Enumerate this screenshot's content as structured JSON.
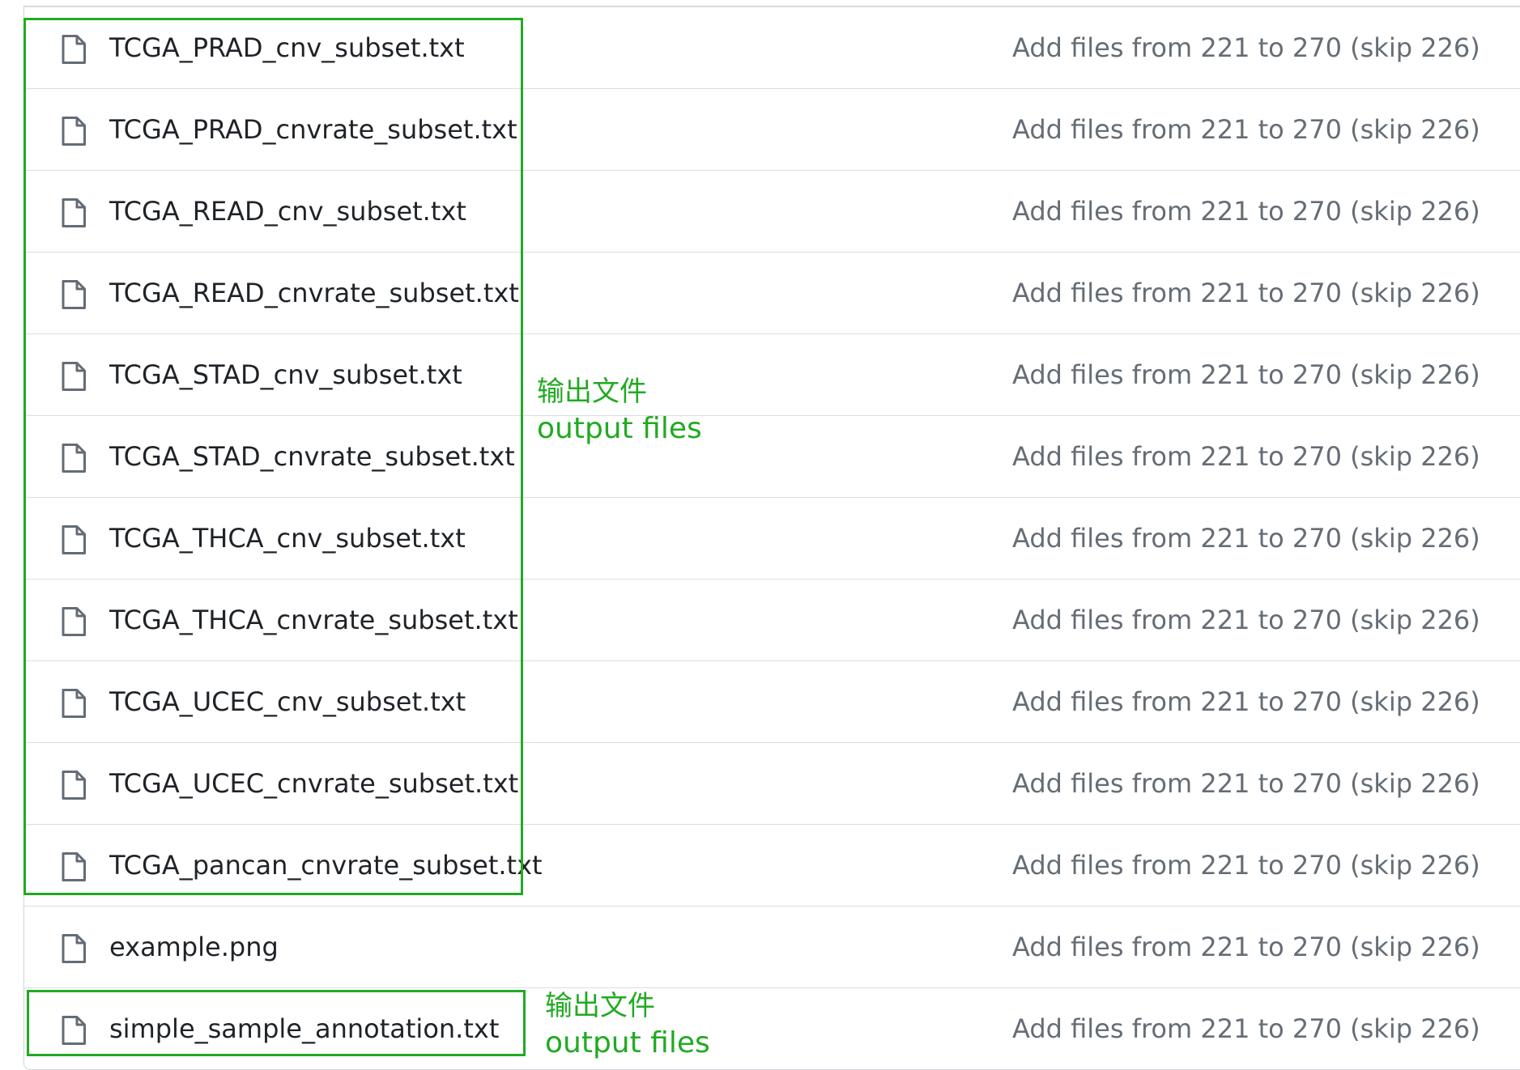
{
  "files": [
    {
      "name": "TCGA_PRAD_cnv_subset.txt",
      "commit": "Add files from 221 to 270 (skip 226)"
    },
    {
      "name": "TCGA_PRAD_cnvrate_subset.txt",
      "commit": "Add files from 221 to 270 (skip 226)"
    },
    {
      "name": "TCGA_READ_cnv_subset.txt",
      "commit": "Add files from 221 to 270 (skip 226)"
    },
    {
      "name": "TCGA_READ_cnvrate_subset.txt",
      "commit": "Add files from 221 to 270 (skip 226)"
    },
    {
      "name": "TCGA_STAD_cnv_subset.txt",
      "commit": "Add files from 221 to 270 (skip 226)"
    },
    {
      "name": "TCGA_STAD_cnvrate_subset.txt",
      "commit": "Add files from 221 to 270 (skip 226)"
    },
    {
      "name": "TCGA_THCA_cnv_subset.txt",
      "commit": "Add files from 221 to 270 (skip 226)"
    },
    {
      "name": "TCGA_THCA_cnvrate_subset.txt",
      "commit": "Add files from 221 to 270 (skip 226)"
    },
    {
      "name": "TCGA_UCEC_cnv_subset.txt",
      "commit": "Add files from 221 to 270 (skip 226)"
    },
    {
      "name": "TCGA_UCEC_cnvrate_subset.txt",
      "commit": "Add files from 221 to 270 (skip 226)"
    },
    {
      "name": "TCGA_pancan_cnvrate_subset.txt",
      "commit": "Add files from 221 to 270 (skip 226)"
    },
    {
      "name": "example.png",
      "commit": "Add files from 221 to 270 (skip 226)"
    },
    {
      "name": "simple_sample_annotation.txt",
      "commit": "Add files from 221 to 270 (skip 226)"
    }
  ],
  "file_icon": "file-icon",
  "annotations": {
    "main": {
      "cn": "输出文件",
      "en": "output files"
    },
    "bottom": {
      "cn": "输出文件",
      "en": "output files"
    }
  },
  "colors": {
    "annotation": "#22aa22",
    "file_name": "#1f2328",
    "commit_message": "#656d76",
    "row_border": "#d8dee4"
  }
}
